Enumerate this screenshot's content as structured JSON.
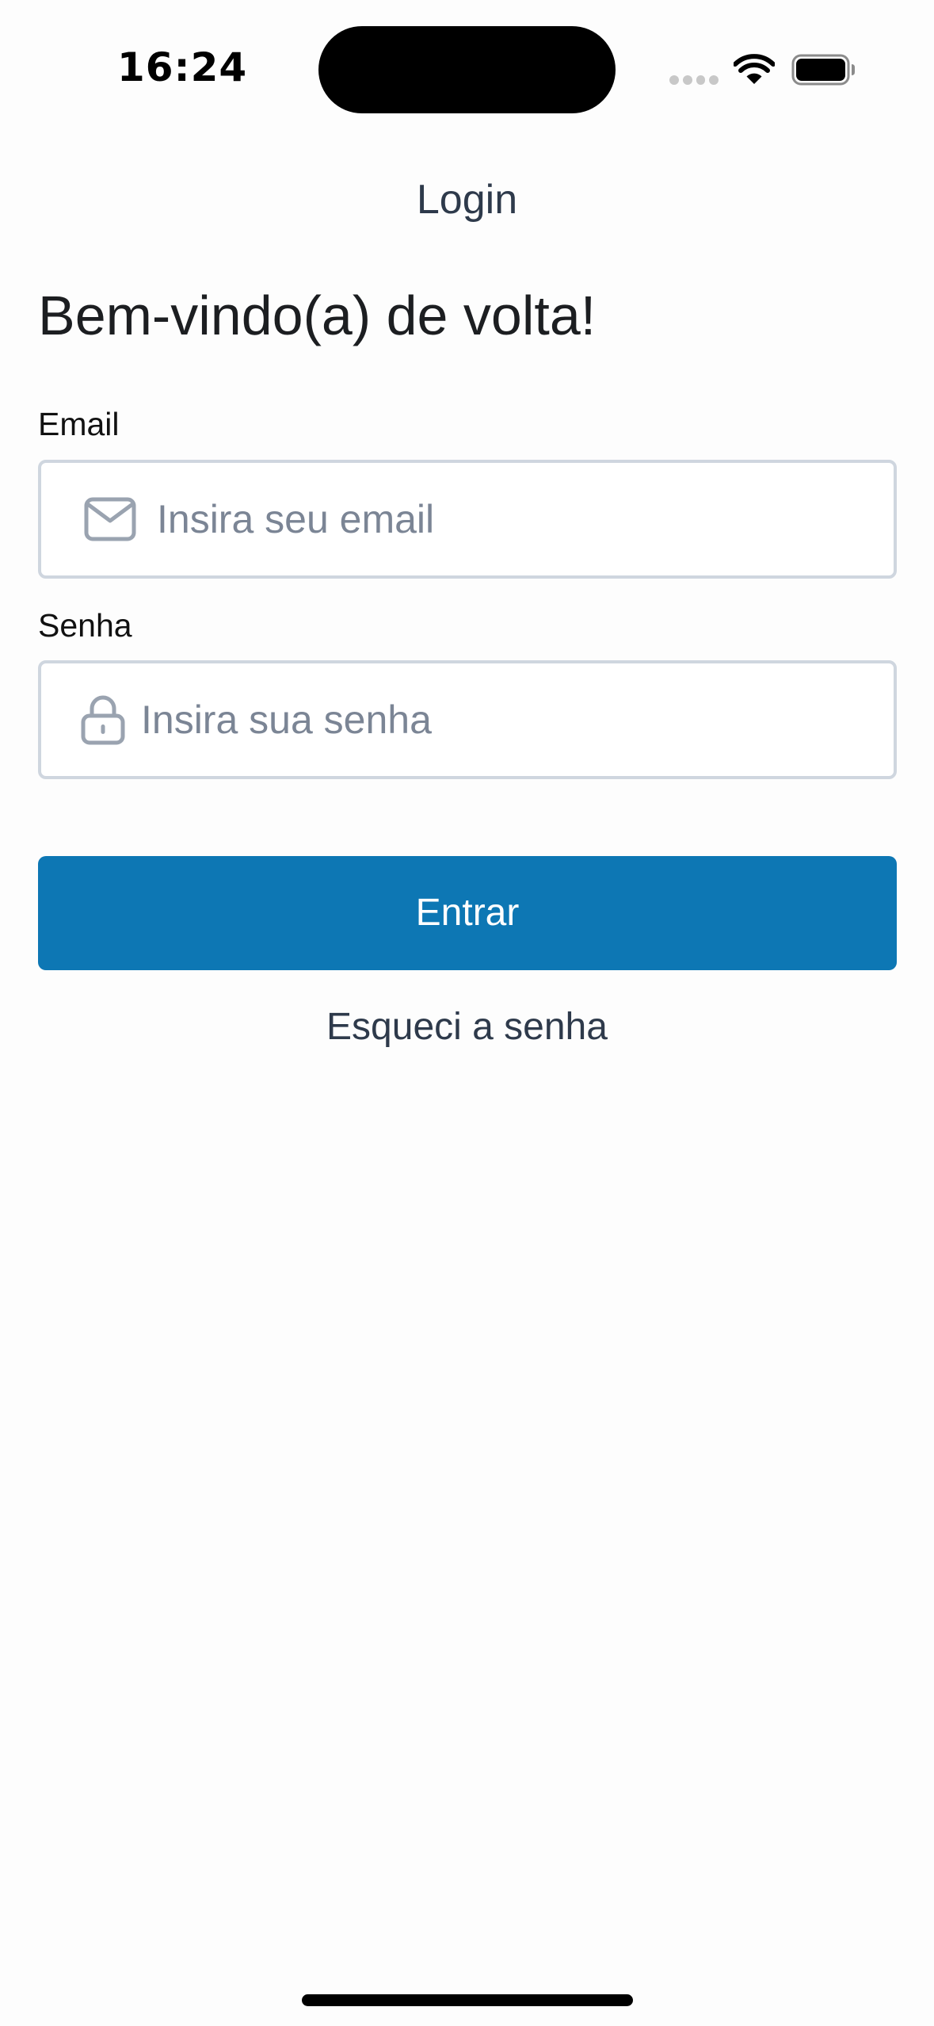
{
  "status_bar": {
    "time": "16:24"
  },
  "nav": {
    "title": "Login"
  },
  "form": {
    "heading": "Bem-vindo(a) de volta!",
    "email": {
      "label": "Email",
      "placeholder": "Insira seu email",
      "icon": "envelope-icon"
    },
    "password": {
      "label": "Senha",
      "placeholder": "Insira sua senha",
      "icon": "lock-icon"
    },
    "submit_label": "Entrar",
    "forgot_label": "Esqueci a senha"
  },
  "colors": {
    "primary": "#0d77b4",
    "border": "#cfd6df",
    "placeholder": "#7b8595",
    "icon": "#9aa3b0"
  }
}
